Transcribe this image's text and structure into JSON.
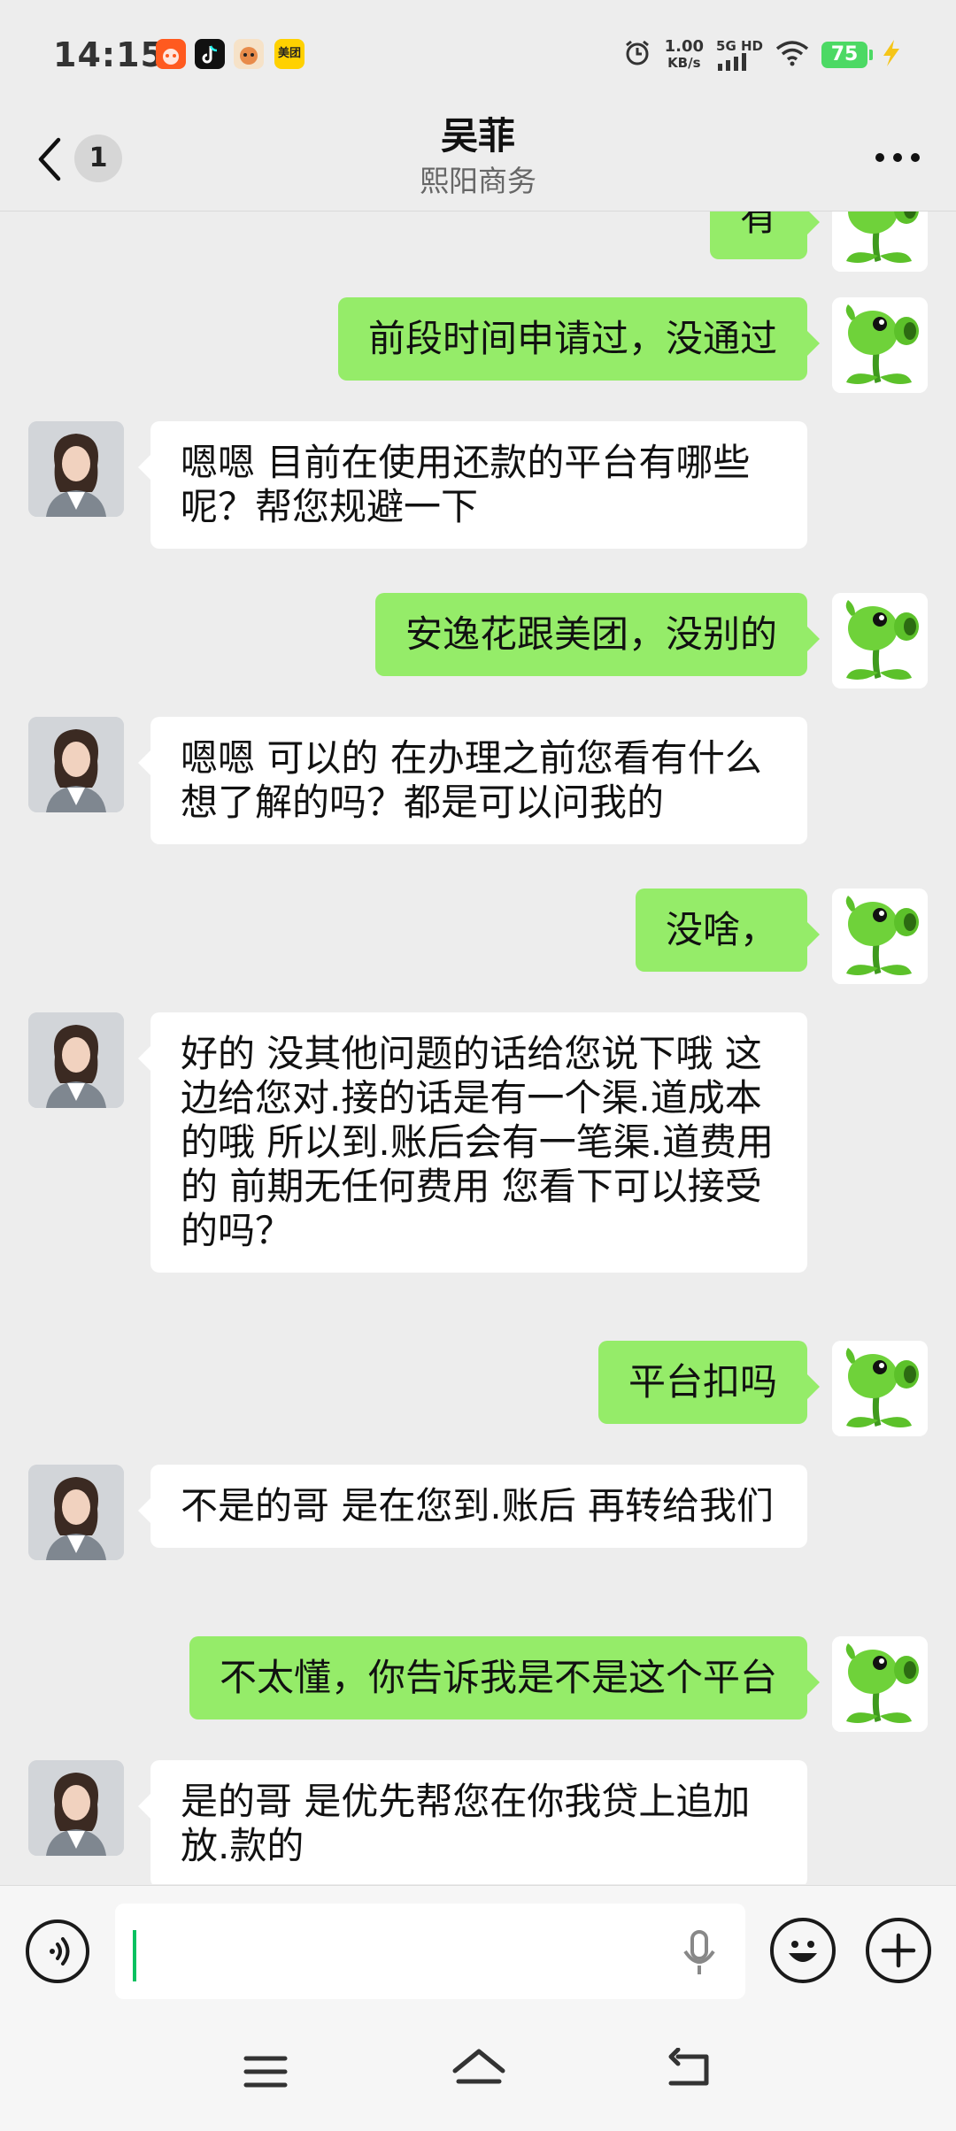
{
  "status_bar": {
    "time": "14:15",
    "net_speed_value": "1.00",
    "net_speed_unit": "KB/s",
    "network_type": "5G HD",
    "battery_level": "75",
    "app_icons": [
      "taobao-icon",
      "tiktok-icon",
      "fox-app-icon",
      "meituan-icon"
    ],
    "meituan_label": "美团"
  },
  "header": {
    "unread_count": "1",
    "title": "吴菲",
    "subtitle": "熙阳商务"
  },
  "messages": [
    {
      "side": "out",
      "text": "有"
    },
    {
      "side": "out",
      "text": "前段时间申请过，没通过"
    },
    {
      "side": "in",
      "text": "嗯嗯  目前在使用还款的平台有哪些呢？帮您规避一下"
    },
    {
      "side": "out",
      "text": "安逸花跟美团，没别的"
    },
    {
      "side": "in",
      "text": "嗯嗯  可以的  在办理之前您看有什么想了解的吗？都是可以问我的"
    },
    {
      "side": "out",
      "text": "没啥，"
    },
    {
      "side": "in",
      "text": "好的 没其他问题的话给您说下哦 这边给您对.接的话是有一个渠.道成本的哦 所以到.账后会有一笔渠.道费用的 前期无任何费用 您看下可以接受的吗？"
    },
    {
      "side": "out",
      "text": "平台扣吗"
    },
    {
      "side": "in",
      "text": "不是的哥  是在您到.账后  再转给我们"
    },
    {
      "side": "out",
      "text": "不太懂，你告诉我是不是这个平台"
    },
    {
      "side": "in",
      "text": "是的哥  是优先帮您在你我贷上追加放.款的"
    }
  ],
  "input": {
    "value": "",
    "placeholder": ""
  },
  "colors": {
    "outgoing_bubble": "#95ec69",
    "incoming_bubble": "#ffffff",
    "background": "#ededed",
    "caret": "#07c160"
  }
}
